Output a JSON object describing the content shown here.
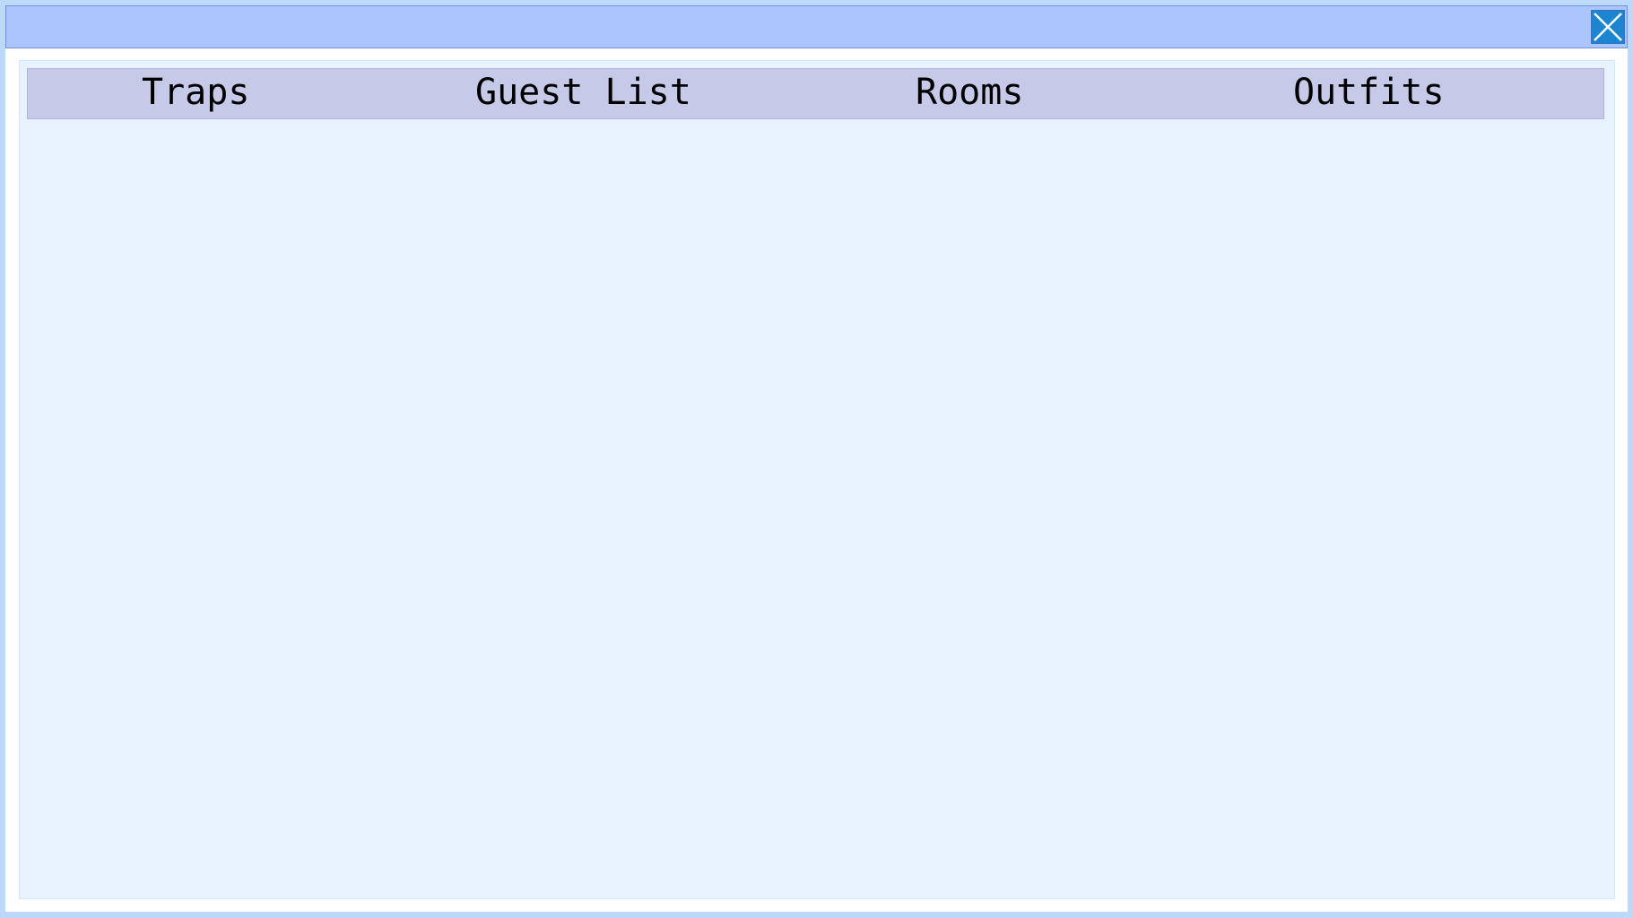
{
  "tabs": {
    "traps": "Traps",
    "guest_list": "Guest List",
    "rooms": "Rooms",
    "outfits": "Outfits"
  },
  "icons": {
    "close": "close-icon"
  },
  "colors": {
    "titlebar": "#acc6fd",
    "close_button": "#1b86cf",
    "panel": "#e8f2ff",
    "tabbar": "#c7c9e8",
    "desktop": "#bcd8fb"
  }
}
